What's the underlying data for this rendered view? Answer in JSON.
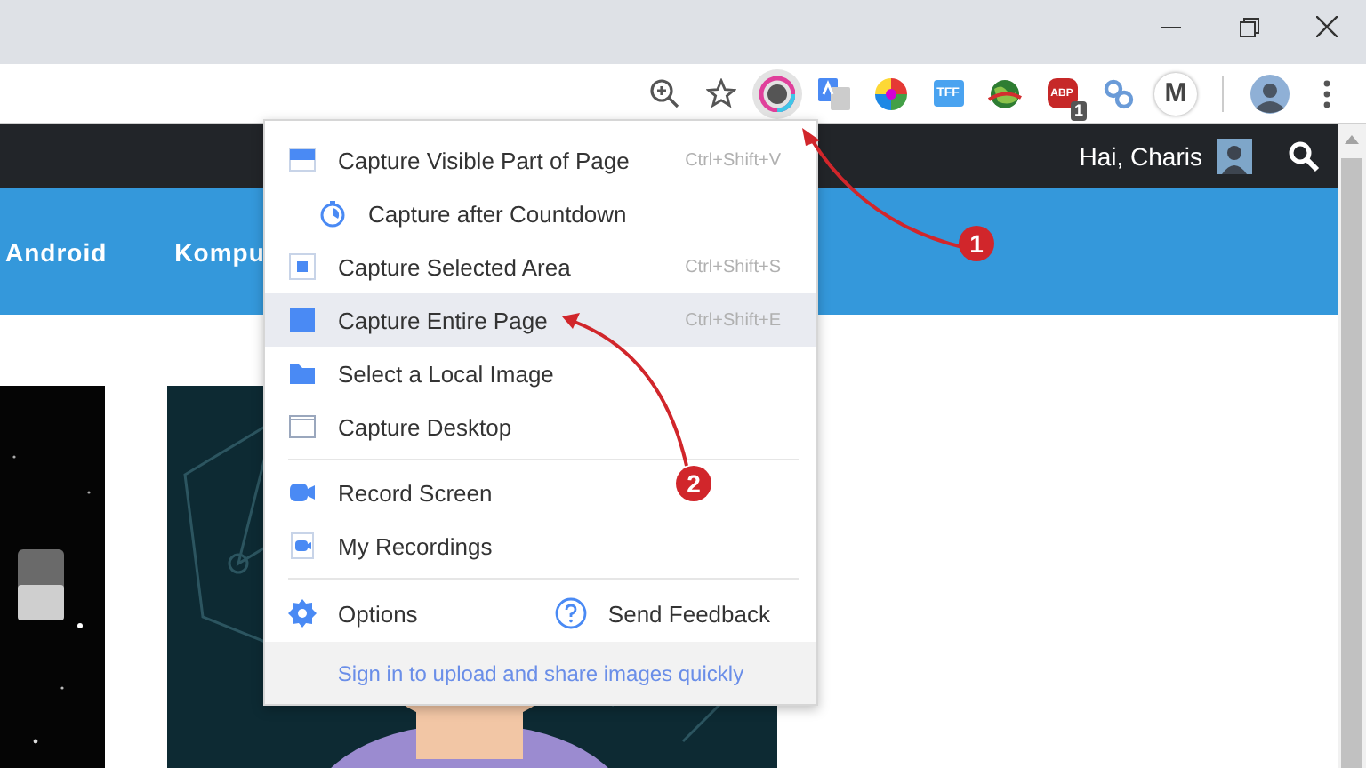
{
  "toolbar": {
    "extensions": [
      {
        "kind": "capture",
        "selected": true
      },
      {
        "kind": "translate",
        "selected": false
      },
      {
        "kind": "colorwheel",
        "selected": false
      },
      {
        "kind": "tff",
        "label": "TFF",
        "selected": false
      },
      {
        "kind": "globe",
        "selected": false
      },
      {
        "kind": "abp",
        "label": "ABP",
        "badge": "1",
        "selected": false
      },
      {
        "kind": "links",
        "selected": false
      },
      {
        "kind": "m",
        "label": "M",
        "selected": false
      }
    ]
  },
  "site": {
    "greeting": "Hai, Charis",
    "nav": [
      "Android",
      "Kompu"
    ]
  },
  "menu": {
    "sections": [
      {
        "items": [
          {
            "kind": "item",
            "label": "Capture Visible Part of Page",
            "shortcut": "Ctrl+Shift+V",
            "selected": false
          },
          {
            "kind": "subitem",
            "label": "Capture after Countdown",
            "selected": false
          },
          {
            "kind": "item",
            "label": "Capture Selected Area",
            "shortcut": "Ctrl+Shift+S",
            "selected": false
          },
          {
            "kind": "item",
            "label": "Capture Entire Page",
            "shortcut": "Ctrl+Shift+E",
            "selected": true
          },
          {
            "kind": "item",
            "label": "Select a Local Image",
            "selected": false
          },
          {
            "kind": "item",
            "label": "Capture Desktop",
            "selected": false
          }
        ]
      },
      {
        "items": [
          {
            "kind": "item",
            "label": "Record Screen",
            "selected": false
          },
          {
            "kind": "item",
            "label": "My Recordings",
            "selected": false
          }
        ]
      }
    ],
    "options": "Options",
    "feedback": "Send Feedback",
    "footer_link": "Sign in to upload and share images quickly"
  },
  "annotations": [
    {
      "label": "1"
    },
    {
      "label": "2"
    }
  ]
}
